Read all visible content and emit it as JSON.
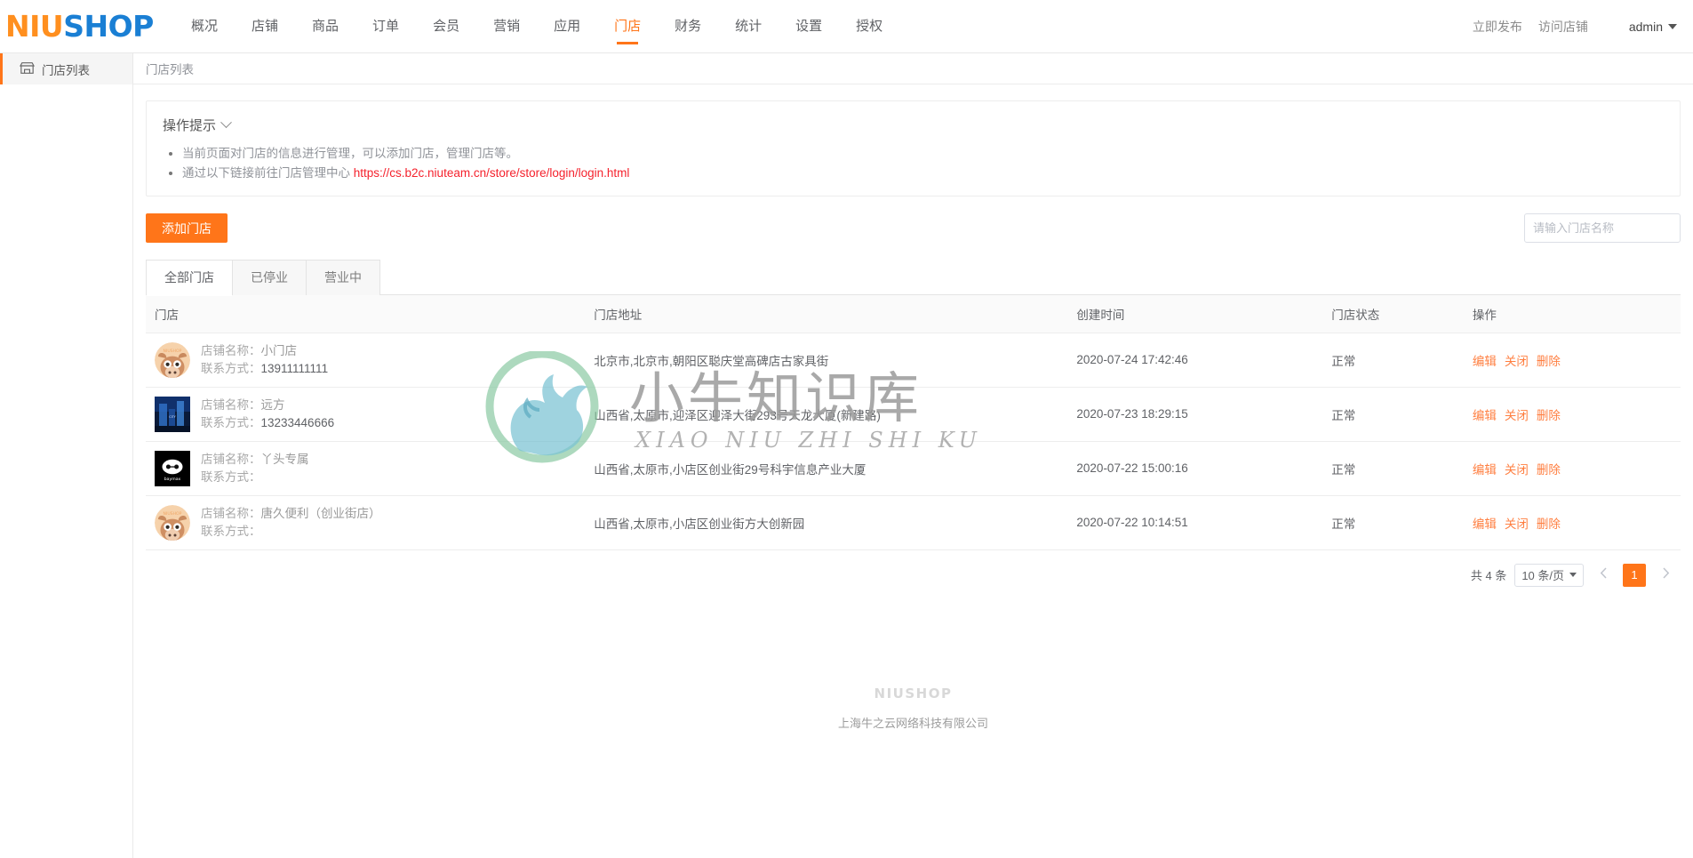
{
  "brand": {
    "logo_part1": "NIU",
    "logo_part2": "SHOP",
    "accent_color": "#ff7519",
    "link_color": "#f5222d"
  },
  "topnav": {
    "items": [
      {
        "label": "概况",
        "active": false
      },
      {
        "label": "店铺",
        "active": false
      },
      {
        "label": "商品",
        "active": false
      },
      {
        "label": "订单",
        "active": false
      },
      {
        "label": "会员",
        "active": false
      },
      {
        "label": "营销",
        "active": false
      },
      {
        "label": "应用",
        "active": false
      },
      {
        "label": "门店",
        "active": true
      },
      {
        "label": "财务",
        "active": false
      },
      {
        "label": "统计",
        "active": false
      },
      {
        "label": "设置",
        "active": false
      },
      {
        "label": "授权",
        "active": false
      }
    ],
    "publish_label": "立即发布",
    "visit_shop_label": "访问店铺",
    "user_label": "admin"
  },
  "sidebar": {
    "items": [
      {
        "label": "门店列表",
        "icon": "shop-icon",
        "active": true
      }
    ]
  },
  "breadcrumb": {
    "text": "门店列表"
  },
  "tip": {
    "title": "操作提示",
    "line1": "当前页面对门店的信息进行管理，可以添加门店，管理门店等。",
    "line2_prefix": "通过以下链接前往门店管理中心",
    "link_text": "https://cs.b2c.niuteam.cn/store/store/login/login.html"
  },
  "toolbar": {
    "add_store_label": "添加门店",
    "search_placeholder": "请输入门店名称",
    "search_value": ""
  },
  "tabs": [
    {
      "label": "全部门店",
      "active": true
    },
    {
      "label": "已停业",
      "active": false
    },
    {
      "label": "营业中",
      "active": false
    }
  ],
  "table": {
    "headers": [
      "门店",
      "门店地址",
      "创建时间",
      "门店状态",
      "操作"
    ],
    "field_labels": {
      "name": "店铺名称：",
      "contact": "联系方式："
    },
    "rows": [
      {
        "avatar": "niushop-cow-avatar",
        "name": "小门店",
        "contact": "13911111111",
        "address": "北京市,北京市,朝阳区聪庆堂高碑店古家具街",
        "created": "2020-07-24 17:42:46",
        "status": "正常",
        "actions": [
          "编辑",
          "关闭",
          "删除"
        ]
      },
      {
        "avatar": "building-photo-avatar",
        "name": "远方",
        "contact": "13233446666",
        "address": "山西省,太原市,迎泽区迎泽大街293号天龙大厦(新建路)",
        "created": "2020-07-23 18:29:15",
        "status": "正常",
        "actions": [
          "编辑",
          "关闭",
          "删除"
        ]
      },
      {
        "avatar": "baymax-avatar",
        "name": "丫头专属",
        "contact": "",
        "address": "山西省,太原市,小店区创业街29号科宇信息产业大厦",
        "created": "2020-07-22 15:00:16",
        "status": "正常",
        "actions": [
          "编辑",
          "关闭",
          "删除"
        ]
      },
      {
        "avatar": "niushop-cow-avatar",
        "name": "唐久便利（创业街店）",
        "contact": "",
        "address": "山西省,太原市,小店区创业街方大创新园",
        "created": "2020-07-22 10:14:51",
        "status": "正常",
        "actions": [
          "编辑",
          "关闭",
          "删除"
        ]
      }
    ]
  },
  "pagination": {
    "total_text": "共 4 条",
    "page_size_label": "10 条/页",
    "prev_icon": "chevron-left-icon",
    "next_icon": "chevron-right-icon",
    "current_page": "1"
  },
  "watermark": {
    "text": "小牛知识库",
    "subtext": "XIAO NIU ZHI SHI KU"
  },
  "footer": {
    "brand": "NIUSHOP",
    "company": "上海牛之云网络科技有限公司"
  }
}
